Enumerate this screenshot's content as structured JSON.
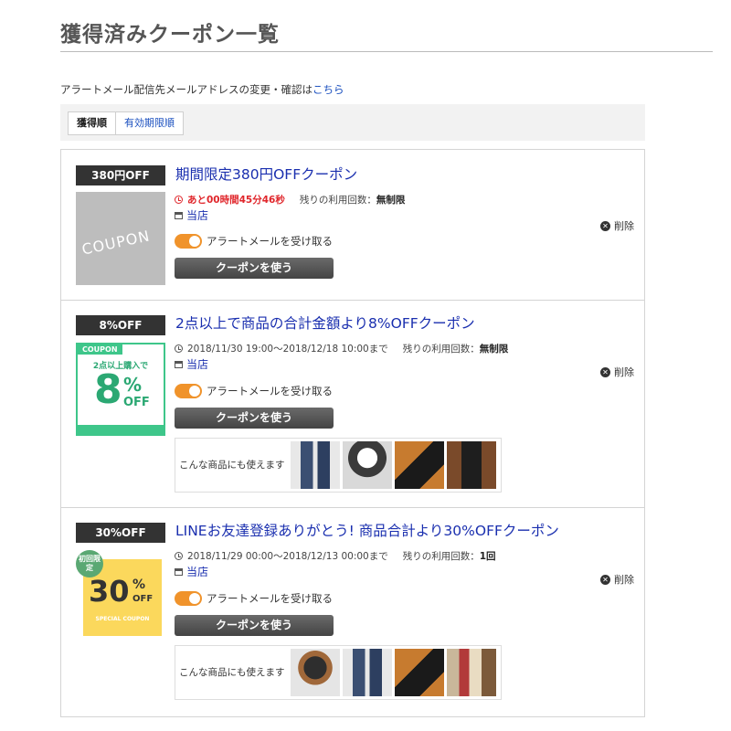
{
  "header": {
    "title": "獲得済みクーポン一覧"
  },
  "alert_note": {
    "text": "アラートメール配信先メールアドレスの変更・確認は",
    "link": "こちら"
  },
  "sort": {
    "tabs": [
      "獲得順",
      "有効期限順"
    ]
  },
  "coupons": [
    {
      "badge": "380円OFF",
      "title": "期間限定380円OFFクーポン",
      "time_text": "あと00時間45分46秒",
      "remaining_label": "残りの利用回数：",
      "remaining_value": "無制限",
      "store": "当店",
      "alert_label": "アラートメールを受け取る",
      "use_label": "クーポンを使う",
      "delete_label": "削除",
      "thumb": {
        "text": "COUPON"
      }
    },
    {
      "badge": "8%OFF",
      "title": "2点以上で商品の合計金額より8%OFFクーポン",
      "time_text": "2018/11/30 19:00〜2018/12/18 10:00まで",
      "remaining_label": "残りの利用回数：",
      "remaining_value": "無制限",
      "store": "当店",
      "alert_label": "アラートメールを受け取る",
      "use_label": "クーポンを使う",
      "delete_label": "削除",
      "products_label": "こんな商品にも使えます",
      "thumb": {
        "ribbon": "COUPON",
        "line1": "2点以上購入で",
        "big": "8",
        "pct": "%",
        "off": "OFF"
      }
    },
    {
      "badge": "30%OFF",
      "title": "LINEお友達登録ありがとう! 商品合計より30%OFFクーポン",
      "time_text": "2018/11/29 00:00〜2018/12/13 00:00まで",
      "remaining_label": "残りの利用回数：",
      "remaining_value": "1回",
      "store": "当店",
      "alert_label": "アラートメールを受け取る",
      "use_label": "クーポンを使う",
      "delete_label": "削除",
      "products_label": "こんな商品にも使えます",
      "thumb": {
        "tag": "初回限定",
        "big": "30",
        "pct": "%",
        "off": "OFF",
        "sub": "SPECIAL COUPON"
      }
    }
  ],
  "colors": {
    "link": "#1a2faf",
    "accent_toggle": "#f0932b",
    "countdown": "#e0262b",
    "badge_bg": "#333333"
  }
}
